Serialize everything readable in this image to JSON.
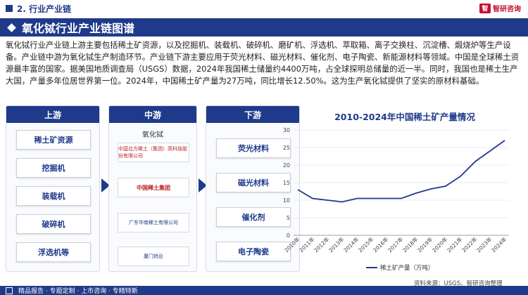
{
  "header": {
    "section_title": "2. 行业产业链",
    "logo_text": "智研咨询",
    "logo_mark": "智"
  },
  "title": "氧化铽行业产业链图谱",
  "paragraph": "氧化铽行业产业链上游主要包括稀土矿资源，以及挖掘机、装载机、破碎机、磨矿机、浮选机、萃取箱、离子交换柱、沉淀槽、煅烧炉等生产设备。产业链中游为氧化铽生产制造环节。产业链下游主要应用于荧光材料、磁光材料、催化剂、电子陶瓷、新能源材料等领域。中国是全球稀土资源最丰富的国家。据美国地质调查局（USGS）数据，2024年我国稀土储量约4400万吨，占全球探明总储量的近一半。同时，我国也是稀土生产大国，产量多年位居世界第一位。2024年，中国稀土矿产量为27万吨，同比增长12.50%。这为生产氧化铽提供了坚实的原材料基础。",
  "chain": {
    "upstream": {
      "label": "上游",
      "items": [
        "稀土矿资源",
        "挖掘机",
        "装载机",
        "破碎机",
        "浮选机等"
      ]
    },
    "midstream": {
      "label": "中游",
      "product": "氧化铽",
      "companies": [
        "中国北方稀土（集团）高科技股份有限公司",
        "中国稀土集团",
        "广东华南稀土有限公司",
        "厦门钨业"
      ]
    },
    "downstream": {
      "label": "下游",
      "items": [
        "荧光材料",
        "磁光材料",
        "催化剂",
        "电子陶瓷"
      ]
    }
  },
  "chart_data": {
    "type": "line",
    "title": "2010-2024年中国稀土矿产量情况",
    "categories": [
      "2010年",
      "2011年",
      "2012年",
      "2013年",
      "2014年",
      "2015年",
      "2016年",
      "2017年",
      "2018年",
      "2019年",
      "2020年",
      "2021年",
      "2022年",
      "2023年",
      "2024年"
    ],
    "series": [
      {
        "name": "稀土矿产量（万吨）",
        "values": [
          13,
          10.5,
          10,
          9.5,
          10.5,
          10.5,
          10.5,
          10.5,
          12,
          13.2,
          14,
          16.8,
          21,
          24,
          27
        ]
      }
    ],
    "ylim": [
      0,
      30
    ],
    "yticks": [
      0,
      5,
      10,
      15,
      20,
      25,
      30
    ],
    "color": "#1f3a8a"
  },
  "source": "资料来源：USGS、智研咨询整理",
  "footer": "精品报告 · 专题定制 · 上市咨询 · 专精特新"
}
